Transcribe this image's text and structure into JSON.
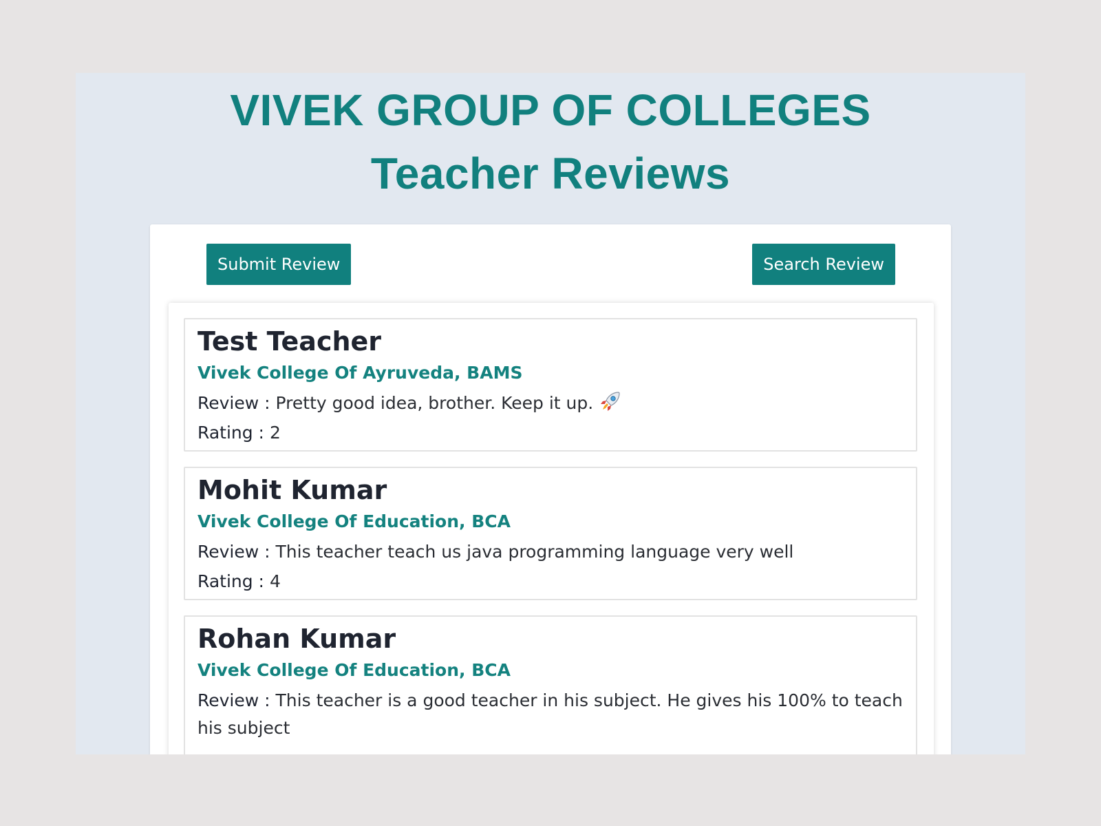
{
  "header": {
    "title": "VIVEK GROUP OF COLLEGES",
    "subtitle": "Teacher Reviews"
  },
  "toolbar": {
    "submit_label": "Submit Review",
    "search_label": "Search Review"
  },
  "labels": {
    "review": "Review :",
    "rating": "Rating :"
  },
  "reviews": [
    {
      "name": "Test Teacher",
      "college": "Vivek College Of Ayruveda, BAMS",
      "review": "Pretty good idea, brother. Keep it up.",
      "review_icon": "rocket-emoji",
      "rating": "2"
    },
    {
      "name": "Mohit Kumar",
      "college": "Vivek College Of Education, BCA",
      "review": "This teacher teach us java programming language very well",
      "rating": "4"
    },
    {
      "name": "Rohan Kumar",
      "college": "Vivek College Of Education, BCA",
      "review": "This teacher is a good teacher in his subject. He gives his 100% to teach his subject"
    }
  ],
  "colors": {
    "accent": "#11807e",
    "page_background": "#e2e8f0",
    "outer_background": "#e7e4e4"
  }
}
